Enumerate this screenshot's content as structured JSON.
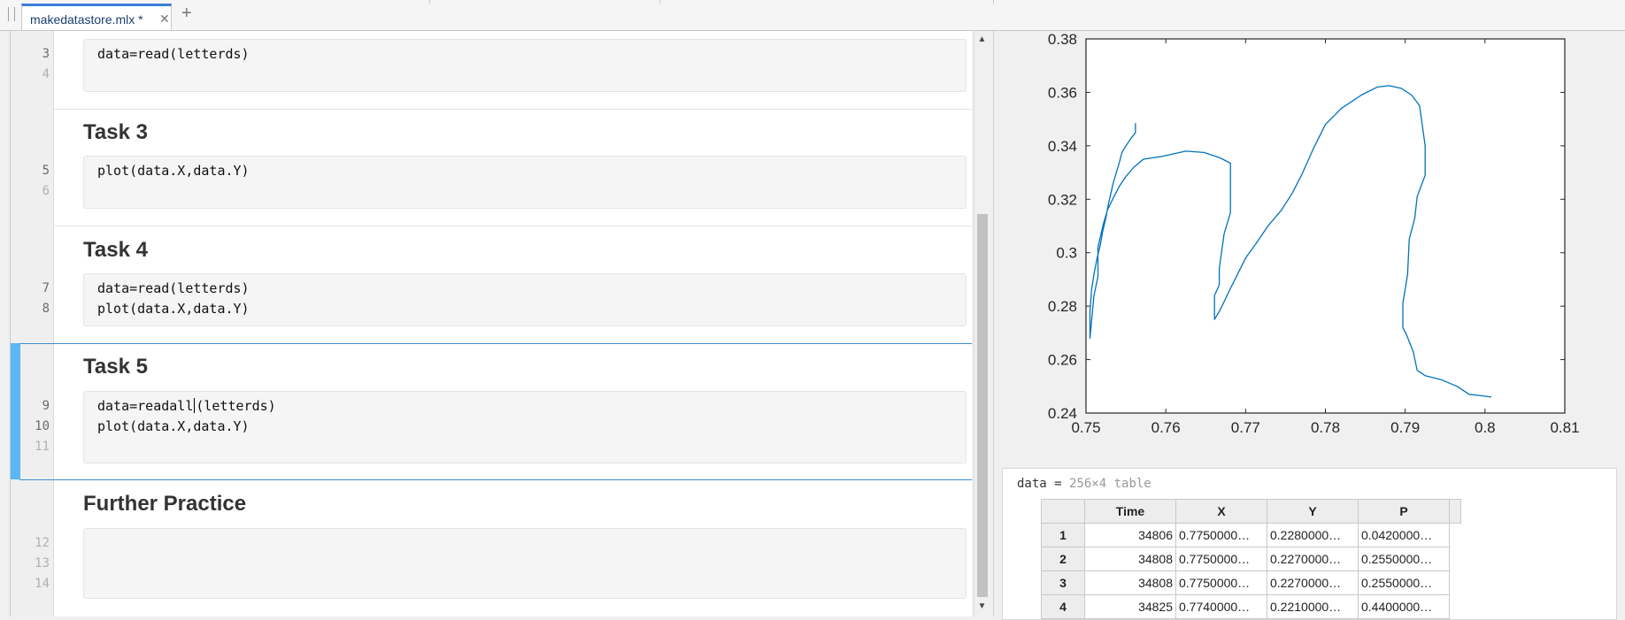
{
  "tabs": [
    {
      "label": "makedatastore.mlx *"
    }
  ],
  "editor": {
    "sections": [
      {
        "title": "",
        "lines": [
          {
            "num": "3",
            "code": "data=read(letterds)"
          },
          {
            "num": "4",
            "code": ""
          }
        ]
      },
      {
        "title": "Task 3",
        "lines": [
          {
            "num": "5",
            "code": "plot(data.X,data.Y)"
          },
          {
            "num": "6",
            "code": ""
          }
        ]
      },
      {
        "title": "Task 4",
        "lines": [
          {
            "num": "7",
            "code": "data=read(letterds)"
          },
          {
            "num": "8",
            "code": "plot(data.X,data.Y)"
          }
        ]
      },
      {
        "title": "Task 5",
        "lines": [
          {
            "num": "9",
            "code_before_caret": "data=readall",
            "code_after_caret": "(letterds)"
          },
          {
            "num": "10",
            "code": "plot(data.X,data.Y)"
          },
          {
            "num": "11",
            "code": ""
          }
        ]
      },
      {
        "title": "Further Practice",
        "lines": [
          {
            "num": "12",
            "code": ""
          },
          {
            "num": "13",
            "code": ""
          },
          {
            "num": "14",
            "code": ""
          }
        ]
      }
    ]
  },
  "chart_data": {
    "type": "line",
    "title": "",
    "xlabel": "",
    "ylabel": "",
    "xlim": [
      0.75,
      0.81
    ],
    "ylim": [
      0.24,
      0.38
    ],
    "xticks": [
      "0.75",
      "0.76",
      "0.77",
      "0.78",
      "0.79",
      "0.8",
      "0.81"
    ],
    "yticks": [
      "0.24",
      "0.26",
      "0.28",
      "0.3",
      "0.32",
      "0.34",
      "0.36",
      "0.38"
    ],
    "grid": false,
    "series": [
      {
        "color": "#0072bd",
        "x": [
          0.7562,
          0.7562,
          0.7557,
          0.755,
          0.7545,
          0.7542,
          0.7538,
          0.7534,
          0.7531,
          0.7528,
          0.7525,
          0.7521,
          0.7518,
          0.7514,
          0.751,
          0.7507,
          0.7505,
          0.7505,
          0.751,
          0.7515,
          0.7515,
          0.7522,
          0.7527,
          0.7535,
          0.7542,
          0.755,
          0.756,
          0.7572,
          0.7595,
          0.7625,
          0.7648,
          0.7668,
          0.7681,
          0.7681,
          0.7673,
          0.7667,
          0.7667,
          0.7661,
          0.7661,
          0.7667,
          0.7672,
          0.768,
          0.769,
          0.77,
          0.7712,
          0.7728,
          0.7745,
          0.7758,
          0.777,
          0.7785,
          0.78,
          0.782,
          0.7845,
          0.7865,
          0.788,
          0.7895,
          0.7908,
          0.7918,
          0.7925,
          0.7925,
          0.7915,
          0.7912,
          0.7905,
          0.7903,
          0.7897,
          0.7897,
          0.7902,
          0.791,
          0.7915,
          0.7925,
          0.7945,
          0.7965,
          0.798,
          0.7995,
          0.8008
        ],
        "y": [
          0.3485,
          0.345,
          0.343,
          0.34,
          0.3375,
          0.334,
          0.33,
          0.326,
          0.322,
          0.318,
          0.313,
          0.308,
          0.303,
          0.298,
          0.292,
          0.286,
          0.278,
          0.268,
          0.284,
          0.291,
          0.302,
          0.311,
          0.316,
          0.321,
          0.325,
          0.3285,
          0.332,
          0.335,
          0.336,
          0.338,
          0.3375,
          0.3355,
          0.3335,
          0.315,
          0.307,
          0.294,
          0.288,
          0.284,
          0.275,
          0.278,
          0.281,
          0.286,
          0.292,
          0.298,
          0.303,
          0.31,
          0.316,
          0.322,
          0.329,
          0.339,
          0.348,
          0.354,
          0.359,
          0.362,
          0.3625,
          0.3615,
          0.359,
          0.355,
          0.34,
          0.329,
          0.321,
          0.313,
          0.305,
          0.292,
          0.281,
          0.272,
          0.269,
          0.263,
          0.256,
          0.254,
          0.2525,
          0.25,
          0.247,
          0.2465,
          0.246
        ]
      }
    ]
  },
  "table": {
    "var": "data",
    "eq": " = ",
    "desc": "256×4 table",
    "columns": [
      "Time",
      "X",
      "Y",
      "P"
    ],
    "rows": [
      [
        "1",
        "34806",
        "0.7750000…",
        "0.2280000…",
        "0.0420000…"
      ],
      [
        "2",
        "34808",
        "0.7750000…",
        "0.2270000…",
        "0.2550000…"
      ],
      [
        "3",
        "34808",
        "0.7750000…",
        "0.2270000…",
        "0.2550000…"
      ],
      [
        "4",
        "34825",
        "0.7740000…",
        "0.2210000…",
        "0.4400000…"
      ]
    ]
  },
  "icons": {
    "close": "close-icon",
    "add": "plus-icon",
    "grip": "grip-icon"
  }
}
